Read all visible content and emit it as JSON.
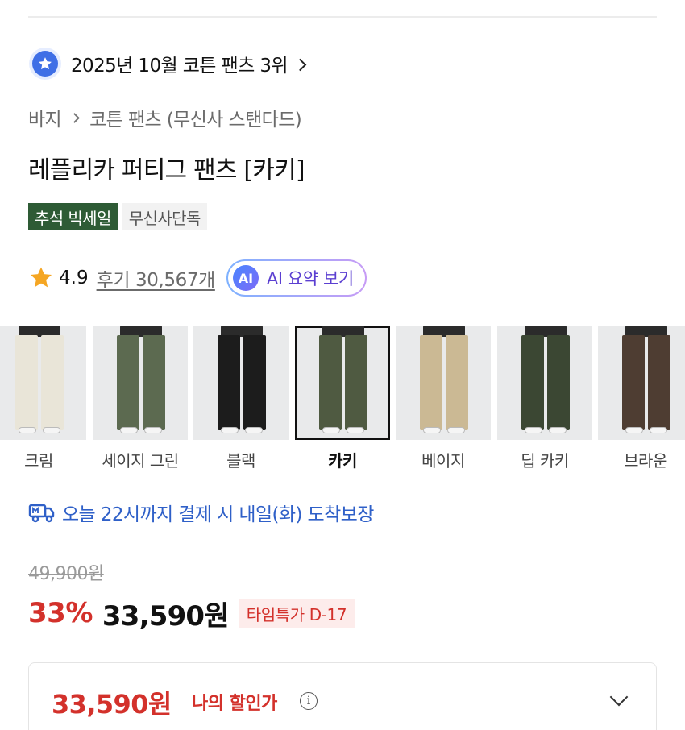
{
  "ranking": {
    "text": "2025년 10월 코튼 팬츠 3위"
  },
  "breadcrumb": {
    "category": "바지",
    "subcategory": "코튼 팬츠 (무신사 스탠다드)"
  },
  "product": {
    "title": "레플리카 퍼티그 팬츠 [카키]"
  },
  "badges": {
    "sale": "추석 빅세일",
    "exclusive": "무신사단독"
  },
  "rating": {
    "score": "4.9",
    "reviews": "후기 30,567개",
    "ai_label": "AI 요약 보기",
    "ai_circle": "AI"
  },
  "colors": {
    "selected": "카키",
    "items": [
      {
        "label": "크림",
        "pants": "#e9e5d8"
      },
      {
        "label": "세이지 그린",
        "pants": "#5c6a50"
      },
      {
        "label": "블랙",
        "pants": "#1c1c1c"
      },
      {
        "label": "카키",
        "pants": "#4f5a41"
      },
      {
        "label": "베이지",
        "pants": "#cbb994"
      },
      {
        "label": "딥 카키",
        "pants": "#3b4733"
      },
      {
        "label": "브라운",
        "pants": "#4e3d32"
      }
    ]
  },
  "delivery": {
    "text": "오늘 22시까지 결제 시 내일(화) 도착보장"
  },
  "price": {
    "original": "49,900원",
    "discount": "33%",
    "current": "33,590원",
    "timer": "타임특가 D-17",
    "my_price": "33,590원",
    "my_price_label": "나의 할인가"
  },
  "theme": {
    "accent_red": "#d3312b",
    "delivery_blue": "#2f60c8",
    "sale_badge": "#2e5b35"
  }
}
